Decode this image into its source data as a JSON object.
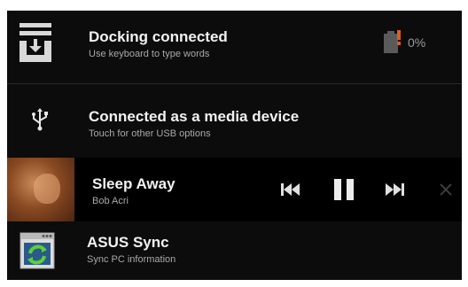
{
  "notifications": {
    "docking": {
      "title": "Docking connected",
      "subtitle": "Use keyboard to type words",
      "icon": "download-tray-icon"
    },
    "battery": {
      "percent_label": "0%",
      "level": 0,
      "icon": "battery-alert-icon"
    },
    "usb": {
      "title": "Connected as a media device",
      "subtitle": "Touch for other USB options",
      "icon": "usb-icon"
    },
    "music": {
      "title": "Sleep Away",
      "artist": "Bob Acri",
      "controls": [
        "previous-track-icon",
        "pause-icon",
        "next-track-icon",
        "close-icon"
      ]
    },
    "asus_sync": {
      "title": "ASUS Sync",
      "subtitle": "Sync PC information",
      "icon": "asus-sync-icon"
    }
  },
  "colors": {
    "panel_background": "#0c0c0c",
    "title_text": "#f2f2f2",
    "subtitle_text": "#a9a9a9",
    "alert_accent": "#e25c1a"
  }
}
